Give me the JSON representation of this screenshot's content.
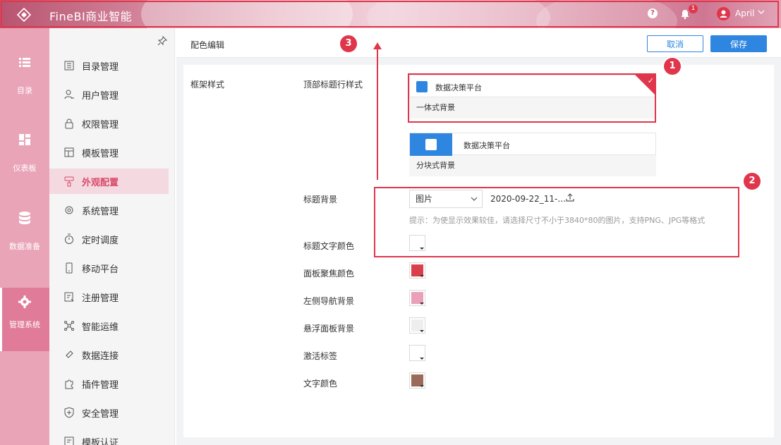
{
  "header": {
    "app_title": "FineBI商业智能",
    "help_label": "?",
    "notification_count": "1",
    "user_name": "April"
  },
  "rail": {
    "items": [
      {
        "label": "目录",
        "icon": "list-icon"
      },
      {
        "label": "仪表板",
        "icon": "dashboard-grid-icon"
      },
      {
        "label": "数据准备",
        "icon": "database-icon"
      },
      {
        "label": "管理系统",
        "icon": "gear-icon"
      }
    ],
    "active_index": 3
  },
  "menu": {
    "items": [
      {
        "label": "目录管理",
        "icon": "catalog-icon"
      },
      {
        "label": "用户管理",
        "icon": "user-icon"
      },
      {
        "label": "权限管理",
        "icon": "lock-icon"
      },
      {
        "label": "模板管理",
        "icon": "template-icon"
      },
      {
        "label": "外观配置",
        "icon": "brush-icon"
      },
      {
        "label": "系统管理",
        "icon": "settings-icon"
      },
      {
        "label": "定时调度",
        "icon": "timer-icon"
      },
      {
        "label": "移动平台",
        "icon": "mobile-icon"
      },
      {
        "label": "注册管理",
        "icon": "register-icon"
      },
      {
        "label": "智能运维",
        "icon": "ops-icon"
      },
      {
        "label": "数据连接",
        "icon": "link-icon"
      },
      {
        "label": "插件管理",
        "icon": "plugin-icon"
      },
      {
        "label": "安全管理",
        "icon": "shield-icon"
      },
      {
        "label": "模板认证",
        "icon": "certificate-icon"
      }
    ],
    "active_index": 4
  },
  "content": {
    "page_title": "配色编辑",
    "cancel_label": "取消",
    "save_label": "保存",
    "section_label": "框架样式",
    "top_title_style_label": "顶部标题行样式",
    "card_unified": {
      "bar_text": "数据决策平台",
      "caption": "一体式背景",
      "selected": true
    },
    "card_block": {
      "bar_text": "数据决策平台",
      "caption": "分块式背景",
      "selected": false
    },
    "title_bg_label": "标题背景",
    "title_bg_type": "图片",
    "title_bg_file": "2020-09-22_11-...",
    "title_bg_hint": "提示：为使显示效果较佳，请选择尺寸不小于3840*80的图片，支持PNG、JPG等格式",
    "color_rows": [
      {
        "label": "标题文字颜色",
        "color": "#ffffff"
      },
      {
        "label": "面板聚焦颜色",
        "color": "#d9404c"
      },
      {
        "label": "左侧导航背景",
        "color": "#e9a0b8"
      },
      {
        "label": "悬浮面板背景",
        "color": "#eeeeee"
      },
      {
        "label": "激活标签",
        "color": "#ffffff"
      },
      {
        "label": "文字颜色",
        "color": "#9a6b58"
      }
    ]
  },
  "annotations": [
    {
      "number": "1"
    },
    {
      "number": "2"
    },
    {
      "number": "3"
    }
  ],
  "colors": {
    "accent": "#2f86e0",
    "annotation_red": "#e0364b",
    "rail_bg": "#e9a4b8",
    "menu_active_text": "#d94a6d"
  }
}
